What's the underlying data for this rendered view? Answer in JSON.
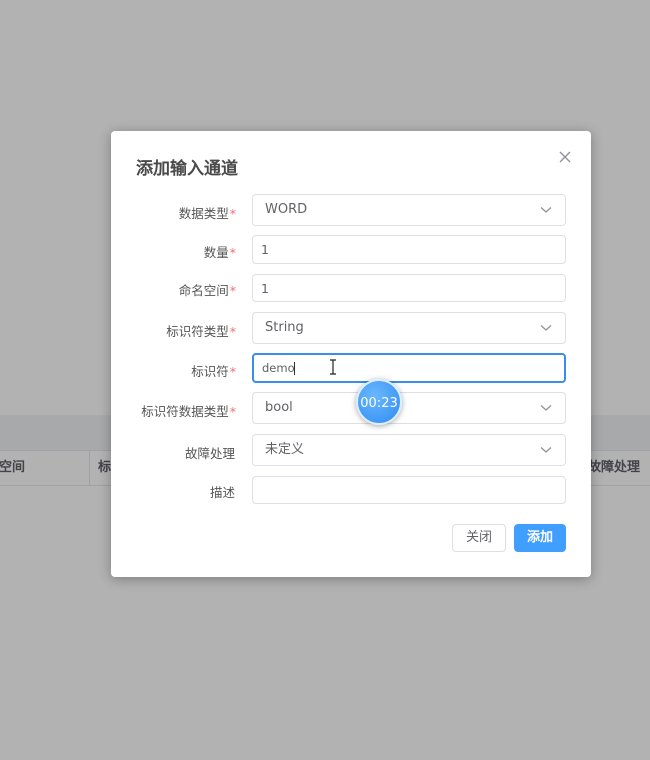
{
  "background": {
    "table_headers": [
      "名空间",
      "标",
      "故障处理"
    ]
  },
  "dialog": {
    "title": "添加输入通道",
    "fields": [
      {
        "label": "数据类型",
        "required": "*",
        "type": "select",
        "value": "WORD"
      },
      {
        "label": "数量",
        "required": "*",
        "type": "input",
        "value": "1"
      },
      {
        "label": "命名空间",
        "required": "*",
        "type": "input",
        "value": "1"
      },
      {
        "label": "标识符类型",
        "required": "*",
        "type": "select",
        "value": "String"
      },
      {
        "label": "标识符",
        "required": "*",
        "type": "input",
        "value": "demo",
        "focused": true
      },
      {
        "label": "标识符数据类型",
        "required": "*",
        "type": "select",
        "value": "bool"
      },
      {
        "label": "故障处理",
        "required": "",
        "type": "select",
        "value": "未定义"
      },
      {
        "label": "描述",
        "required": "",
        "type": "input",
        "value": ""
      }
    ],
    "buttons": {
      "close": "关闭",
      "add": "添加"
    }
  },
  "overlay": {
    "timer": "00:23"
  },
  "colors": {
    "primary": "#409eff",
    "required": "#f56c6c",
    "focus_border": "#3a8ee6"
  }
}
